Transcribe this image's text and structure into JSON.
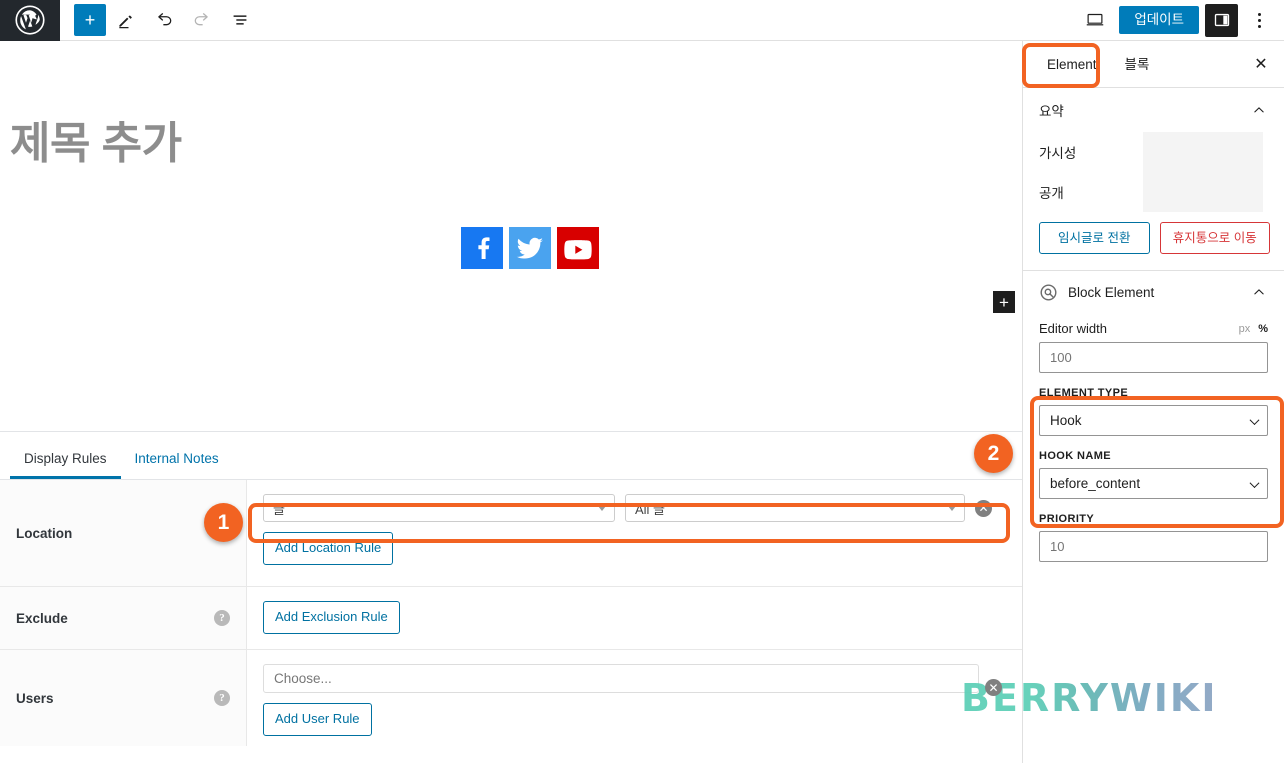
{
  "topbar": {
    "logo_icon": "wordpress-logo-icon",
    "inserter_label": "+",
    "tools": [
      {
        "name": "block-inserter-button",
        "icon": "plus-icon",
        "label": "+"
      },
      {
        "name": "edit-tool-button",
        "icon": "pencil-icon",
        "label": ""
      },
      {
        "name": "undo-button",
        "icon": "undo-arrow-icon",
        "label": ""
      },
      {
        "name": "redo-button",
        "icon": "redo-arrow-icon",
        "label": ""
      },
      {
        "name": "list-view-button",
        "icon": "list-view-icon",
        "label": ""
      }
    ],
    "preview_icon": "desktop-preview-icon",
    "update_label": "업데이트",
    "settings_toggle_icon": "sidebar-panel-icon",
    "options_icon": "kebab-menu-icon"
  },
  "editor": {
    "title_placeholder": "제목 추가",
    "social_icons": [
      {
        "name": "facebook-icon",
        "label": "Facebook",
        "color": "#1778f2"
      },
      {
        "name": "twitter-icon",
        "label": "Twitter",
        "color": "#4aa3ef"
      },
      {
        "name": "youtube-icon",
        "label": "YouTube",
        "color": "#d80000"
      }
    ],
    "inserter_label": "+"
  },
  "metabox": {
    "tabs": [
      {
        "label": "Display Rules",
        "active": true
      },
      {
        "label": "Internal Notes",
        "active": false
      }
    ],
    "rows": [
      {
        "label": "Location",
        "help": "?",
        "select_post_type": "글",
        "select_post_scope": "All 글",
        "clear_label": "✕",
        "button": "Add Location Rule"
      },
      {
        "label": "Exclude",
        "help": "?",
        "button": "Add Exclusion Rule"
      },
      {
        "label": "Users",
        "help": "?",
        "choose_placeholder": "Choose...",
        "clear_label": "✕",
        "button": "Add User Rule"
      }
    ]
  },
  "sidebar": {
    "tabs": [
      {
        "label": "Element",
        "active": true
      },
      {
        "label": "블록",
        "active": false
      }
    ],
    "close_label": "✕",
    "summary": {
      "title": "요약",
      "chevron": "⌃",
      "fields": [
        {
          "label": "가시성"
        },
        {
          "label": "공개"
        }
      ],
      "switch_to_draft": "임시글로 전환",
      "move_to_trash": "휴지통으로 이동"
    },
    "block_element": {
      "icon": "generateblocks-logo-icon",
      "title": "Block Element",
      "chevron": "⌃",
      "editor_width": {
        "label": "Editor width",
        "units": [
          {
            "label": "px",
            "active": false
          },
          {
            "label": "%",
            "active": true
          }
        ],
        "value": "100"
      },
      "element_type": {
        "label": "ELEMENT TYPE",
        "value": "Hook"
      },
      "hook_name": {
        "label": "HOOK NAME",
        "value": "before_content"
      },
      "priority": {
        "label": "PRIORITY",
        "value": "10"
      }
    }
  },
  "annotations": {
    "badges": [
      {
        "label": "1",
        "target": "location-rule-row"
      },
      {
        "label": "2",
        "target": "element-type-group"
      }
    ],
    "highlight_color": "#f26322"
  },
  "watermark": {
    "text": "BERRYWIKI"
  }
}
